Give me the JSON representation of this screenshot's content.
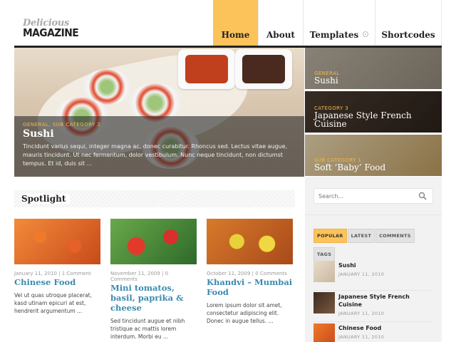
{
  "logo": {
    "top": "Delicious",
    "bottom": "MAGAZINE"
  },
  "nav": {
    "items": [
      "Home",
      "About",
      "Templates",
      "Shortcodes"
    ]
  },
  "hero": {
    "category": "GENERAL, SUB CATEGORY 2",
    "title": "Sushi",
    "text": "Tincidunt varius sequi, integer magna ac, donec curabitur. Rhoncus sed. Lectus vitae augue, mauris tincidunt. Ut nec fermentum, dolor vestibulum. Nunc neque tincidunt, non dictumst tempus. Et id, duis sit ..."
  },
  "slides": [
    {
      "category": "GENERAL",
      "title": "Sushi"
    },
    {
      "category": "CATEGORY 3",
      "title": "Japanese Style French Cuisine"
    },
    {
      "category": "SUB CATEGORY 1",
      "title": "Soft ‘Baby’ Food"
    }
  ],
  "spotlight": {
    "title": "Spotlight",
    "cards": [
      {
        "meta": "January 11, 2010 | 1 Comment",
        "title": "Chinese Food",
        "text": "Vel ut quas utroque placerat, kasd utinam epicuri at est, hendrerit argumentum ..."
      },
      {
        "meta": "November 11, 2009 | 0 Comments",
        "title": "Mini tomatos, basil, paprika & cheese",
        "text": "Sed tincidunt augue et nibh tristique ac mattis lorem interdum. Morbi eu ..."
      },
      {
        "meta": "October 11, 2009 | 0 Comments",
        "title": "Khandvi – Mumbai Food",
        "text": "Lorem ipsum dolor sit amet, consectetur adipiscing elit. Donec in augue tellus. ..."
      }
    ]
  },
  "sidebar": {
    "search_placeholder": "Search...",
    "tabs": [
      "POPULAR",
      "LATEST",
      "COMMENTS",
      "TAGS"
    ],
    "posts": [
      {
        "title": "Sushi",
        "date": "JANUARY 11, 2010"
      },
      {
        "title": "Japanese Style French Cuisine",
        "date": "JANUARY 11, 2010"
      },
      {
        "title": "Chinese Food",
        "date": "JANUARY 11, 2010"
      }
    ]
  },
  "colors": {
    "accent": "#fbc35a",
    "link": "#3a8bb0",
    "category": "#f3b84a"
  }
}
